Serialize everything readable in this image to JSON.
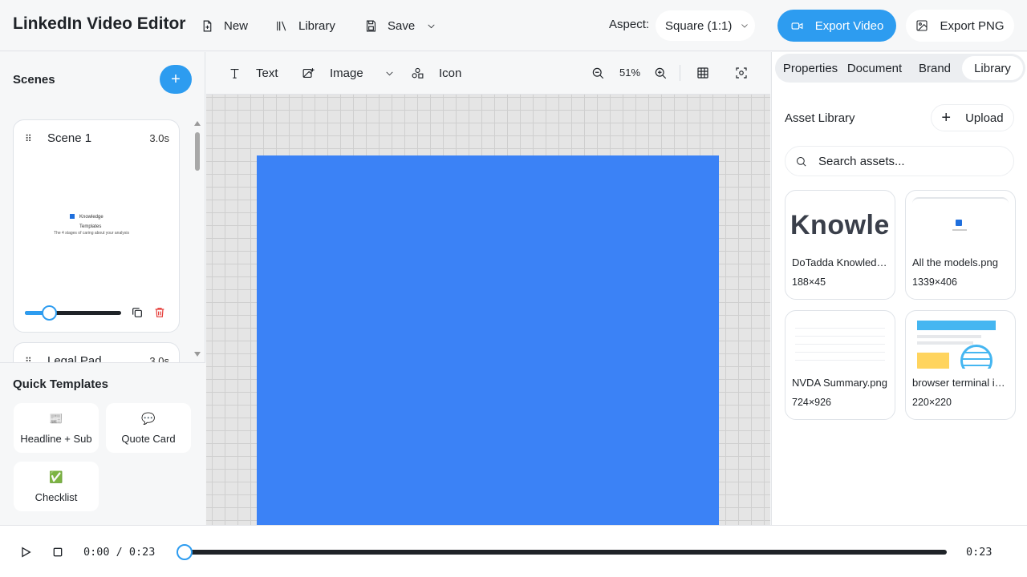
{
  "header": {
    "title": "LinkedIn Video Editor",
    "new_label": "New",
    "library_label": "Library",
    "save_label": "Save",
    "aspect_label": "Aspect:",
    "aspect_value": "Square (1:1)",
    "export_video_label": "Export Video",
    "export_png_label": "Export PNG"
  },
  "scenes": {
    "title": "Scenes",
    "add_label": "+",
    "items": [
      {
        "name": "Scene 1",
        "duration": "3.0s",
        "duration_fraction": 0.26,
        "thumb_line1": "Knowledge",
        "thumb_line2": "Templates",
        "thumb_line3": "The 4 stages of caring about your analysis"
      },
      {
        "name": "Legal Pad",
        "duration": "3.0s"
      }
    ]
  },
  "quick_templates": {
    "title": "Quick Templates",
    "items": [
      {
        "label": "Headline + Sub",
        "icon": "📰"
      },
      {
        "label": "Quote Card",
        "icon": "💬"
      },
      {
        "label": "Checklist",
        "icon": "✅"
      }
    ]
  },
  "toolbar": {
    "text_label": "Text",
    "image_label": "Image",
    "icon_label": "Icon",
    "zoom": "51%"
  },
  "canvas": {
    "artboard_color": "#3b82f6"
  },
  "right_panel": {
    "tabs": [
      "Properties",
      "Document",
      "Brand",
      "Library"
    ],
    "active_tab": "Library",
    "asset_title": "Asset Library",
    "upload_label": "Upload",
    "search_placeholder": "Search assets...",
    "thumb_text_knowledge": "Knowledge",
    "assets": [
      {
        "name": "DoTadda Knowledge.png",
        "size": "188×45"
      },
      {
        "name": "All the models.png",
        "size": "1339×406"
      },
      {
        "name": "NVDA Summary.png",
        "size": "724×926"
      },
      {
        "name": "browser terminal icon.png",
        "size": "220×220"
      }
    ]
  },
  "playback": {
    "time_current": "0:00 / 0:23",
    "time_end": "0:23",
    "progress_fraction": 0.0
  },
  "colors": {
    "accent": "#2d9cf0",
    "delete": "#e53935"
  }
}
